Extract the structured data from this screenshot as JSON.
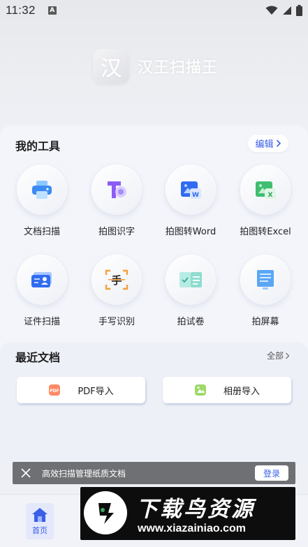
{
  "status_bar": {
    "time": "11:32",
    "notification_badge": "A",
    "icons": [
      "wifi-icon",
      "signal-icon",
      "battery-icon"
    ]
  },
  "brand": {
    "logo_text": "汉",
    "name": "汉王扫描王"
  },
  "tools_section": {
    "title": "我的工具",
    "edit_label": "编辑",
    "tools": [
      {
        "label": "文档扫描",
        "icon": "printer-icon"
      },
      {
        "label": "拍图识字",
        "icon": "text-recognition-icon"
      },
      {
        "label": "拍图转Word",
        "icon": "word-icon"
      },
      {
        "label": "拍图转Excel",
        "icon": "excel-icon"
      },
      {
        "label": "证件扫描",
        "icon": "id-card-icon"
      },
      {
        "label": "手写识别",
        "icon": "handwriting-icon"
      },
      {
        "label": "拍试卷",
        "icon": "exam-paper-icon"
      },
      {
        "label": "拍屏幕",
        "icon": "screen-icon"
      }
    ]
  },
  "recent_section": {
    "title": "最近文档",
    "all_label": "全部",
    "pdf_import_label": "PDF导入",
    "album_import_label": "相册导入"
  },
  "login_banner": {
    "text": "高效扫描管理纸质文档",
    "button_label": "登录"
  },
  "bottom_nav": {
    "home_label": "首页"
  },
  "watermark": {
    "title": "下载鸟资源",
    "url": "www.xiazainiao.com"
  },
  "colors": {
    "accent": "#3a5ee8",
    "background": "#eef0f6",
    "banner": "#6f7073"
  }
}
